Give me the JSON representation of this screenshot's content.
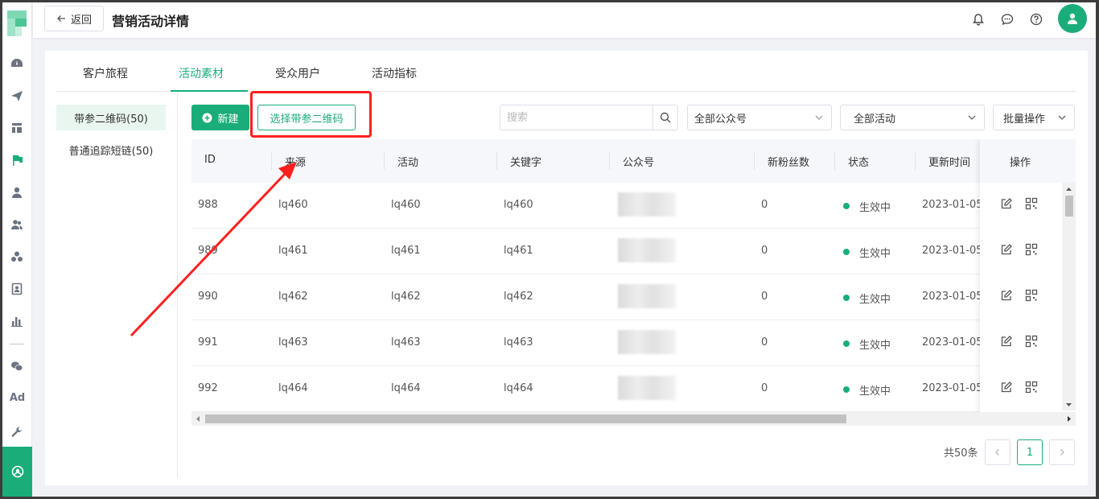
{
  "header": {
    "back_label": "返回",
    "title": "营销活动详情"
  },
  "rail": {
    "ad_label": "Ad"
  },
  "tabs": [
    {
      "label": "客户旅程"
    },
    {
      "label": "活动素材"
    },
    {
      "label": "受众用户"
    },
    {
      "label": "活动指标"
    }
  ],
  "side": [
    {
      "label": "带参二维码(50)"
    },
    {
      "label": "普通追踪短链(50)"
    }
  ],
  "toolbar": {
    "new_label": "新建",
    "select_label": "选择带参二维码",
    "search_placeholder": "搜索",
    "account_filter": "全部公众号",
    "activity_filter": "全部活动",
    "batch_label": "批量操作"
  },
  "table": {
    "columns": [
      "ID",
      "来源",
      "活动",
      "关键字",
      "公众号",
      "新粉丝数",
      "状态",
      "更新时间",
      "操作"
    ],
    "rows": [
      {
        "id": "988",
        "source": "lq460",
        "activity": "lq460",
        "keyword": "lq460",
        "fans": "0",
        "status": "生效中",
        "updated": "2023-01-05"
      },
      {
        "id": "989",
        "source": "lq461",
        "activity": "lq461",
        "keyword": "lq461",
        "fans": "0",
        "status": "生效中",
        "updated": "2023-01-05"
      },
      {
        "id": "990",
        "source": "lq462",
        "activity": "lq462",
        "keyword": "lq462",
        "fans": "0",
        "status": "生效中",
        "updated": "2023-01-05"
      },
      {
        "id": "991",
        "source": "lq463",
        "activity": "lq463",
        "keyword": "lq463",
        "fans": "0",
        "status": "生效中",
        "updated": "2023-01-05"
      },
      {
        "id": "992",
        "source": "lq464",
        "activity": "lq464",
        "keyword": "lq464",
        "fans": "0",
        "status": "生效中",
        "updated": "2023-01-05"
      }
    ]
  },
  "pagination": {
    "total": "共50条",
    "current": "1"
  },
  "colors": {
    "accent": "#1aad7a",
    "annotation": "#ff1f1f"
  }
}
